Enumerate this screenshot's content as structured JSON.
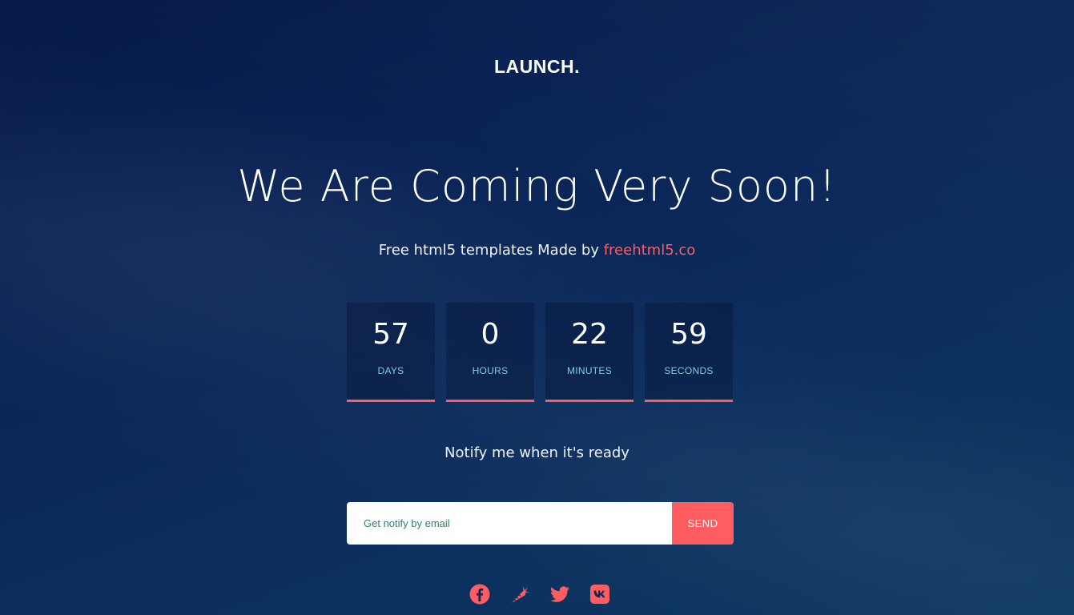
{
  "brand": {
    "logo": "LAUNCH."
  },
  "hero": {
    "headline": "We Are Coming Very Soon!",
    "sub_prefix": "Free html5 templates Made by ",
    "sub_link": "freehtml5.co"
  },
  "countdown": [
    {
      "value": "57",
      "label": "DAYS"
    },
    {
      "value": "0",
      "label": "HOURS"
    },
    {
      "value": "22",
      "label": "MINUTES"
    },
    {
      "value": "59",
      "label": "SECONDS"
    }
  ],
  "notify": {
    "title": "Notify me when it's ready",
    "placeholder": "Get notify by email",
    "button": "SEND"
  },
  "social": [
    {
      "icon": "facebook-icon"
    },
    {
      "icon": "carrot-icon"
    },
    {
      "icon": "twitter-icon"
    },
    {
      "icon": "vk-icon"
    }
  ],
  "colors": {
    "accent": "#ff5d62",
    "label": "#7fd0d6",
    "background_top": "#061a4a",
    "background_bottom": "#0a3560"
  }
}
